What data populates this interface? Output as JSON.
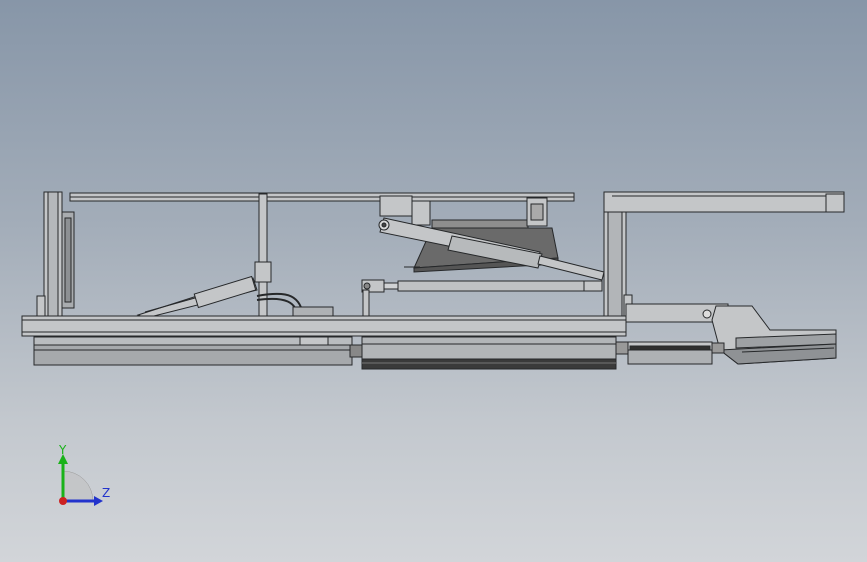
{
  "viewport": {
    "background_top": "#8796a8",
    "background_bottom": "#d2d5d9"
  },
  "model": {
    "part_fill": "#c4c6c8",
    "part_dark": "#6b6e71",
    "edge_color": "#26282a",
    "shadow_fill": "#6a6a6a"
  },
  "triad": {
    "y_label": "Y",
    "z_label": "Z",
    "y_color": "#19b219",
    "z_color": "#2233cc",
    "x_color": "#cc2222"
  }
}
